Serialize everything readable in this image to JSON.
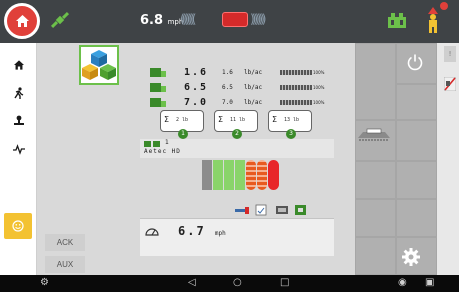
{
  "topbar": {
    "speed_value": "6.8",
    "speed_unit": "mph",
    "chevrons_left": "((((((((",
    "chevrons_right": "))))))))",
    "center_bar_color": "#d52a2a",
    "icons": [
      "home-icon",
      "gps-satellite-icon",
      "implement-icon",
      "alert-figure-icon"
    ]
  },
  "sidebar": {
    "items": [
      {
        "name": "home-icon"
      },
      {
        "name": "walk-icon"
      },
      {
        "name": "hitch-icon"
      },
      {
        "name": "signal-icon"
      },
      {
        "name": "smiley-icon",
        "accent": "#f3c232"
      }
    ]
  },
  "main": {
    "rates": [
      {
        "value": "1.6",
        "target": "1.6",
        "unit": "lb/ac",
        "pct": "100%"
      },
      {
        "value": "6.5",
        "target": "6.5",
        "unit": "lb/ac",
        "pct": "100%"
      },
      {
        "value": "7.0",
        "target": "7.0",
        "unit": "lb/ac",
        "pct": "100%"
      }
    ],
    "summaries": [
      {
        "symbol": "Σ",
        "value": "2 lb",
        "badge": "1"
      },
      {
        "symbol": "Σ",
        "value": "11 lb",
        "badge": "2"
      },
      {
        "symbol": "Σ",
        "value": "13 lb",
        "badge": "3"
      }
    ],
    "device_number": "1",
    "device_name": "Aetec HD",
    "speed_value": "6.7",
    "speed_unit": "mph",
    "buttons": {
      "ack": "ACK",
      "aux": "AUX"
    }
  },
  "right": {
    "power_icon": "power-icon",
    "gear_icon": "gear-icon",
    "side_button_label": "!"
  },
  "colors": {
    "topbar": "#3f4346",
    "accent_green": "#6cc04a",
    "alert_red": "#e0403a",
    "panel_gray": "#d9d9d9"
  }
}
